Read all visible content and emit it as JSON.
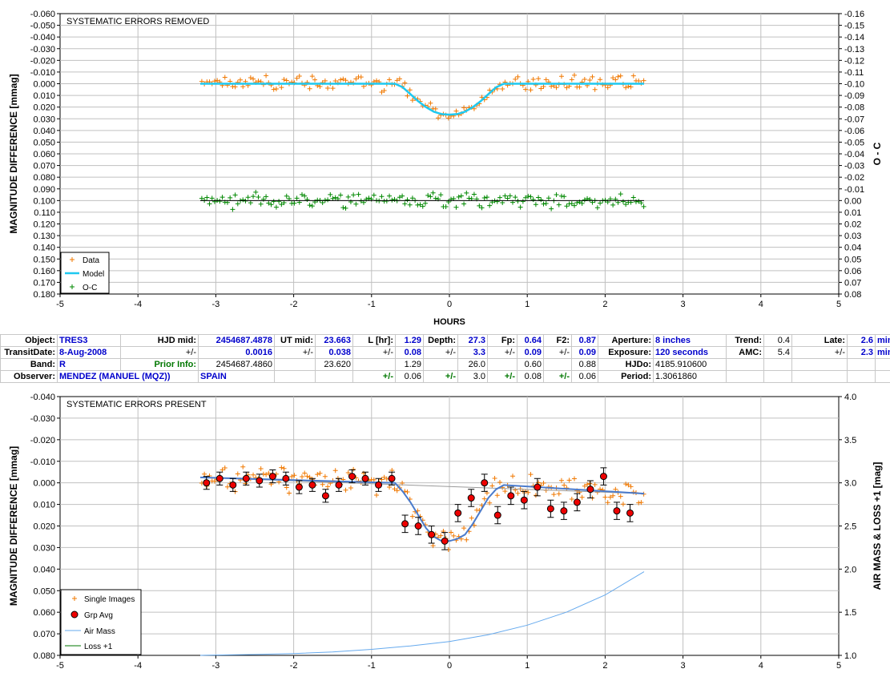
{
  "colors": {
    "data": "#f07800",
    "model": "#1ec8f0",
    "oc": "#008800",
    "grp": "#ee0000",
    "airmass": "#66aaee",
    "loss": "#007700",
    "model2": "#4a7bcc"
  },
  "chart_data": [
    {
      "type": "scatter",
      "title": "SYSTEMATIC ERRORS REMOVED",
      "xlabel": "HOURS",
      "ylabel": "MAGNITUDE DIFFERENCE [mmag]",
      "y2label": "O - C",
      "xlim": [
        -5,
        5
      ],
      "ylim": [
        -0.06,
        0.18
      ],
      "y_inverted": true,
      "y2lim": [
        -0.16,
        0.08
      ],
      "x_ticks": [
        "-5",
        "-4",
        "-3",
        "-2",
        "-1",
        "0",
        "1",
        "2",
        "3",
        "4",
        "5"
      ],
      "y_ticks": [
        "-0.060",
        "-0.050",
        "-0.040",
        "-0.030",
        "-0.020",
        "-0.010",
        "0.000",
        "0.010",
        "0.020",
        "0.030",
        "0.040",
        "0.050",
        "0.060",
        "0.070",
        "0.080",
        "0.090",
        "0.100",
        "0.110",
        "0.120",
        "0.130",
        "0.140",
        "0.150",
        "0.160",
        "0.170",
        "0.180"
      ],
      "y2_ticks": [
        "-0.16",
        "-0.15",
        "-0.14",
        "-0.13",
        "-0.12",
        "-0.11",
        "-0.10",
        "-0.09",
        "-0.08",
        "-0.07",
        "-0.06",
        "-0.05",
        "-0.04",
        "-0.03",
        "-0.02",
        "-0.01",
        "0.00",
        "0.01",
        "0.02",
        "0.03",
        "0.04",
        "0.05",
        "0.06",
        "0.07",
        "0.08"
      ],
      "legend": [
        "Data",
        "Model",
        "O-C"
      ],
      "legend_position": "bottom-left",
      "grid": true,
      "model": {
        "name": "Model",
        "x": [
          -3.2,
          -0.7,
          -0.6,
          -0.5,
          -0.4,
          -0.3,
          -0.2,
          -0.1,
          0.0,
          0.1,
          0.2,
          0.3,
          0.4,
          0.5,
          0.6,
          0.7,
          2.5
        ],
        "y": [
          0.0,
          0.0,
          0.003,
          0.009,
          0.015,
          0.02,
          0.024,
          0.026,
          0.0265,
          0.026,
          0.024,
          0.02,
          0.015,
          0.009,
          0.003,
          0.0,
          0.0
        ]
      },
      "oc_line": {
        "x": [
          -3.2,
          2.5
        ],
        "y": [
          0.0,
          0.0
        ]
      }
    },
    {
      "type": "scatter",
      "title": "SYSTEMATIC ERRORS PRESENT",
      "xlabel": "",
      "ylabel": "MAGNITUDE DIFFERENCE [mmag]",
      "y2label": "AIR MASS & LOSS +1 [mag]",
      "xlim": [
        -5,
        5
      ],
      "ylim": [
        -0.04,
        0.08
      ],
      "y_inverted": true,
      "y2lim": [
        1.0,
        4.0
      ],
      "x_ticks": [
        "-5",
        "-4",
        "-3",
        "-2",
        "-1",
        "0",
        "1",
        "2",
        "3",
        "4",
        "5"
      ],
      "y_ticks": [
        "-0.040",
        "-0.030",
        "-0.020",
        "-0.010",
        "0.000",
        "0.010",
        "0.020",
        "0.030",
        "0.040",
        "0.050",
        "0.060",
        "0.070",
        "0.080"
      ],
      "y2_ticks": [
        "1.0",
        "1.5",
        "2.0",
        "2.5",
        "3.0",
        "3.5",
        "4.0"
      ],
      "legend": [
        "Single Images",
        "Grp Avg",
        "Air Mass",
        "Loss +1"
      ],
      "legend_position": "bottom-left",
      "grid": true,
      "grp_avg": {
        "x": [
          -3.12,
          -2.95,
          -2.78,
          -2.61,
          -2.44,
          -2.27,
          -2.1,
          -1.93,
          -1.76,
          -1.59,
          -1.42,
          -1.25,
          -1.08,
          -0.91,
          -0.74,
          -0.57,
          -0.4,
          -0.23,
          -0.06,
          0.11,
          0.28,
          0.45,
          0.62,
          0.79,
          0.96,
          1.13,
          1.3,
          1.47,
          1.64,
          1.81,
          1.98,
          2.15,
          2.32
        ],
        "y": [
          0.0,
          -0.002,
          0.001,
          -0.002,
          -0.001,
          -0.003,
          -0.002,
          0.002,
          0.001,
          0.006,
          0.001,
          -0.003,
          -0.002,
          0.001,
          -0.002,
          0.019,
          0.02,
          0.024,
          0.027,
          0.014,
          0.007,
          0.0,
          0.015,
          0.006,
          0.008,
          0.002,
          0.012,
          0.013,
          0.009,
          0.003,
          -0.003,
          0.013,
          0.014
        ],
        "err": [
          0.003,
          0.003,
          0.003,
          0.003,
          0.003,
          0.003,
          0.003,
          0.003,
          0.003,
          0.003,
          0.003,
          0.003,
          0.003,
          0.003,
          0.003,
          0.004,
          0.004,
          0.004,
          0.004,
          0.004,
          0.004,
          0.004,
          0.004,
          0.004,
          0.004,
          0.004,
          0.004,
          0.004,
          0.004,
          0.004,
          0.004,
          0.004,
          0.004
        ]
      },
      "model": {
        "name": "Model",
        "x": [
          -3.2,
          -0.7,
          -0.6,
          -0.5,
          -0.4,
          -0.3,
          -0.2,
          -0.1,
          0.0,
          0.1,
          0.2,
          0.3,
          0.4,
          0.5,
          0.6,
          0.7,
          2.5
        ],
        "y": [
          -0.0025,
          0.0,
          0.004,
          0.009,
          0.015,
          0.021,
          0.025,
          0.027,
          0.027,
          0.026,
          0.024,
          0.019,
          0.013,
          0.007,
          0.003,
          0.001,
          0.005
        ]
      },
      "air_mass": {
        "name": "Air Mass",
        "x": [
          -3.2,
          -2.5,
          -2.0,
          -1.5,
          -1.0,
          -0.5,
          0.0,
          0.5,
          1.0,
          1.5,
          2.0,
          2.5
        ],
        "y": [
          1.0,
          1.01,
          1.02,
          1.04,
          1.07,
          1.11,
          1.16,
          1.24,
          1.35,
          1.5,
          1.7,
          1.97
        ]
      }
    }
  ],
  "info_table": {
    "rows": [
      [
        {
          "t": "Object:",
          "c": "lbl",
          "w": 66
        },
        {
          "t": "TRES3",
          "c": "val",
          "w": 74
        },
        {
          "t": "HJD mid:",
          "c": "lbl",
          "w": 92
        },
        {
          "t": "2454687.4878",
          "c": "val num",
          "w": 90
        },
        {
          "t": "UT mid:",
          "c": "lbl",
          "w": 46
        },
        {
          "t": "23.663",
          "c": "val num",
          "w": 42
        },
        {
          "t": "L [hr]:",
          "c": "lbl",
          "w": 48
        },
        {
          "t": "1.29",
          "c": "val num",
          "w": 30
        },
        {
          "t": "Depth:",
          "c": "lbl",
          "w": 38
        },
        {
          "t": "27.3",
          "c": "val num",
          "w": 32
        },
        {
          "t": "Fp:",
          "c": "lbl",
          "w": 32
        },
        {
          "t": "0.64",
          "c": "val num",
          "w": 28
        },
        {
          "t": "F2:",
          "c": "lbl",
          "w": 30
        },
        {
          "t": "0.87",
          "c": "val num",
          "w": 28
        },
        {
          "t": "Aperture:",
          "c": "lbl",
          "w": 64
        },
        {
          "t": "8 inches",
          "c": "val",
          "w": 86
        },
        {
          "t": "Trend:",
          "c": "lbl",
          "w": 42
        },
        {
          "t": "0.4",
          "c": "val num plain",
          "w": 30
        },
        {
          "t": "Late:",
          "c": "lbl",
          "w": 64
        },
        {
          "t": "2.6",
          "c": "val num",
          "w": 30
        },
        {
          "t": "min",
          "c": "val",
          "w": 32
        }
      ],
      [
        {
          "t": "TransitDate:",
          "c": "lbl",
          "w": 66
        },
        {
          "t": "8-Aug-2008",
          "c": "val",
          "w": 74
        },
        {
          "t": "+/-",
          "c": "lbl plain",
          "w": 92
        },
        {
          "t": "0.0016",
          "c": "val num",
          "w": 90
        },
        {
          "t": "+/-",
          "c": "lbl plain",
          "w": 46
        },
        {
          "t": "0.038",
          "c": "val num",
          "w": 42
        },
        {
          "t": "+/-",
          "c": "lbl plain",
          "w": 48
        },
        {
          "t": "0.08",
          "c": "val num",
          "w": 30
        },
        {
          "t": "+/-",
          "c": "lbl plain",
          "w": 38
        },
        {
          "t": "3.3",
          "c": "val num",
          "w": 32
        },
        {
          "t": "+/-",
          "c": "lbl plain",
          "w": 32
        },
        {
          "t": "0.09",
          "c": "val num",
          "w": 28
        },
        {
          "t": "+/-",
          "c": "lbl plain",
          "w": 30
        },
        {
          "t": "0.09",
          "c": "val num",
          "w": 28
        },
        {
          "t": "Exposure:",
          "c": "lbl",
          "w": 64
        },
        {
          "t": "120 seconds",
          "c": "val",
          "w": 86
        },
        {
          "t": "AMC:",
          "c": "lbl",
          "w": 42
        },
        {
          "t": "5.4",
          "c": "val num plain",
          "w": 30
        },
        {
          "t": "+/-",
          "c": "lbl plain",
          "w": 64
        },
        {
          "t": "2.3",
          "c": "val num",
          "w": 30
        },
        {
          "t": "min",
          "c": "val",
          "w": 32
        }
      ],
      [
        {
          "t": "Band:",
          "c": "lbl",
          "w": 66
        },
        {
          "t": "R",
          "c": "val",
          "w": 74
        },
        {
          "t": "Prior Info:",
          "c": "grn num",
          "w": 92
        },
        {
          "t": "2454687.4860",
          "c": "num plain",
          "w": 90
        },
        {
          "t": "",
          "c": "",
          "w": 46
        },
        {
          "t": "23.620",
          "c": "num plain",
          "w": 42
        },
        {
          "t": "",
          "c": "",
          "w": 48
        },
        {
          "t": "1.29",
          "c": "num plain",
          "w": 30
        },
        {
          "t": "",
          "c": "",
          "w": 38
        },
        {
          "t": "26.0",
          "c": "num plain",
          "w": 32
        },
        {
          "t": "",
          "c": "",
          "w": 32
        },
        {
          "t": "0.60",
          "c": "num plain",
          "w": 28
        },
        {
          "t": "",
          "c": "",
          "w": 30
        },
        {
          "t": "0.88",
          "c": "num plain",
          "w": 28
        },
        {
          "t": "HJDo:",
          "c": "lbl",
          "w": 64
        },
        {
          "t": "4185.910600",
          "c": "plain",
          "w": 86
        },
        {
          "t": "",
          "c": "",
          "w": 42
        },
        {
          "t": "",
          "c": "",
          "w": 30
        },
        {
          "t": "",
          "c": "",
          "w": 64
        },
        {
          "t": "",
          "c": "",
          "w": 30
        },
        {
          "t": "",
          "c": "",
          "w": 32
        }
      ],
      [
        {
          "t": "Observer:",
          "c": "lbl",
          "w": 66
        },
        {
          "t": "MENDEZ (MANUEL (MQZ))",
          "c": "val",
          "w": 166,
          "span": 2
        },
        {
          "t": "SPAIN",
          "c": "val",
          "w": 90
        },
        {
          "t": "",
          "c": "",
          "w": 46
        },
        {
          "t": "",
          "c": "",
          "w": 42
        },
        {
          "t": "+/-",
          "c": "grn num",
          "w": 48
        },
        {
          "t": "0.06",
          "c": "num plain",
          "w": 30
        },
        {
          "t": "+/-",
          "c": "grn num",
          "w": 38
        },
        {
          "t": "3.0",
          "c": "num plain",
          "w": 32
        },
        {
          "t": "+/-",
          "c": "grn num",
          "w": 32
        },
        {
          "t": "0.08",
          "c": "num plain",
          "w": 28
        },
        {
          "t": "+/-",
          "c": "grn num",
          "w": 30
        },
        {
          "t": "0.06",
          "c": "num plain",
          "w": 28
        },
        {
          "t": "Period:",
          "c": "lbl",
          "w": 64
        },
        {
          "t": "1.3061860",
          "c": "plain",
          "w": 86
        },
        {
          "t": "",
          "c": "",
          "w": 42
        },
        {
          "t": "",
          "c": "",
          "w": 30
        },
        {
          "t": "",
          "c": "",
          "w": 64
        },
        {
          "t": "",
          "c": "",
          "w": 30
        },
        {
          "t": "",
          "c": "",
          "w": 32
        }
      ]
    ]
  }
}
